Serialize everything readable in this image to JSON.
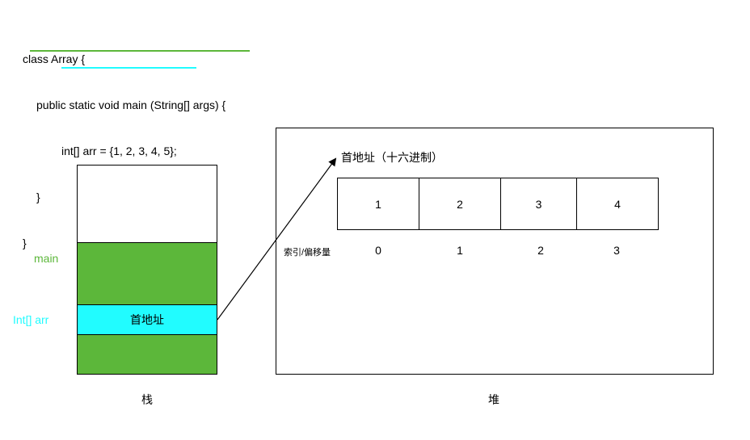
{
  "code": {
    "lines": [
      "class Array {",
      "public static void main (String[] args) {",
      "int[] arr = {1, 2, 3, 4, 5};",
      "}",
      "}"
    ]
  },
  "stack": {
    "caption": "栈",
    "main_label": "main",
    "arr_label": "Int[] arr",
    "address_cell": "首地址"
  },
  "heap": {
    "caption": "堆",
    "address_label": "首地址（十六进制）",
    "index_label": "索引/偏移量",
    "values": [
      "1",
      "2",
      "3",
      "4"
    ],
    "indices": [
      "0",
      "1",
      "2",
      "3"
    ]
  },
  "colors": {
    "green": "#5cb73a",
    "cyan": "#21fcff",
    "label_green": "#5cb73a",
    "label_cyan": "#21fcff",
    "underline_green": "#5cb73a",
    "underline_cyan": "#21fcff"
  }
}
